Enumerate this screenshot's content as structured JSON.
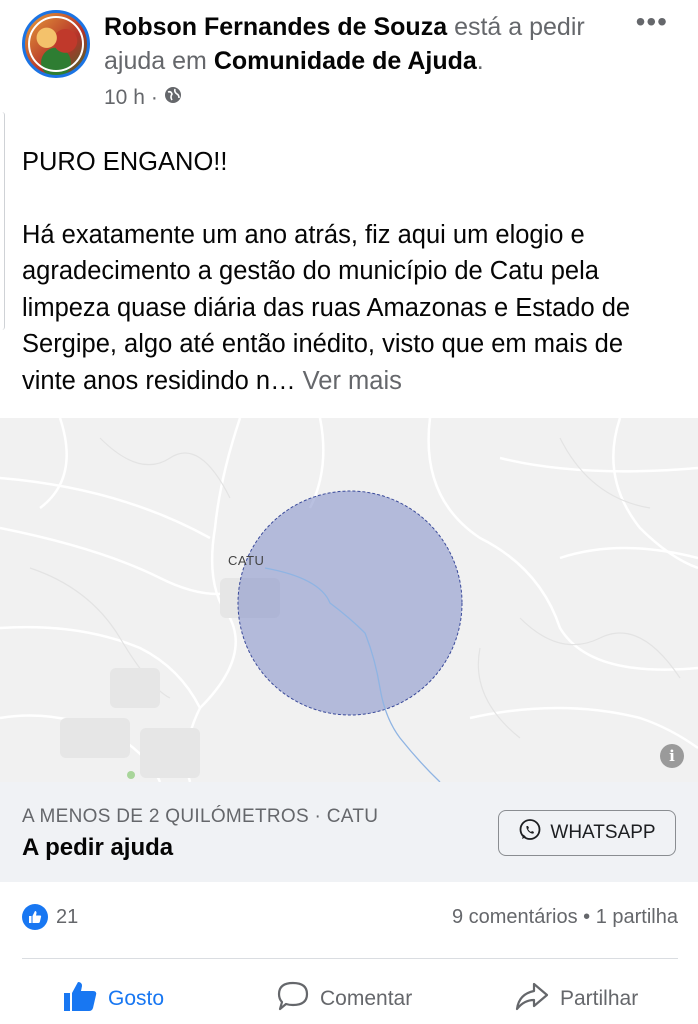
{
  "post": {
    "author": "Robson Fernandes de Souza",
    "action_text": "está a pedir ajuda em",
    "group": "Comunidade de Ajuda",
    "period": ".",
    "time": "10 h",
    "dot": "·",
    "more_label": "•••",
    "headline": "PURO ENGANO!!",
    "body": "Há exatamente um ano atrás, fiz aqui um elogio e agradecimento a gestão do município de Catu pela limpeza quase diária das ruas Amazonas e Estado de Sergipe, algo até então inédito, visto que em mais de vinte anos residindo n…",
    "see_more": "Ver mais"
  },
  "map": {
    "city_label": "CATU",
    "info_label": "i",
    "circle_color": "#7f8cc7"
  },
  "help_strip": {
    "distance": "A MENOS DE 2 QUILÓMETROS · CATU",
    "title": "A pedir ajuda",
    "whatsapp_label": "WHATSAPP"
  },
  "engagement": {
    "likes": "21",
    "comments": "9 comentários",
    "sep": "•",
    "shares": "1 partilha"
  },
  "actions": {
    "like_label": "Gosto",
    "comment_label": "Comentar",
    "share_label": "Partilhar"
  },
  "colors": {
    "accent": "#1877f2",
    "muted": "#65676b"
  }
}
